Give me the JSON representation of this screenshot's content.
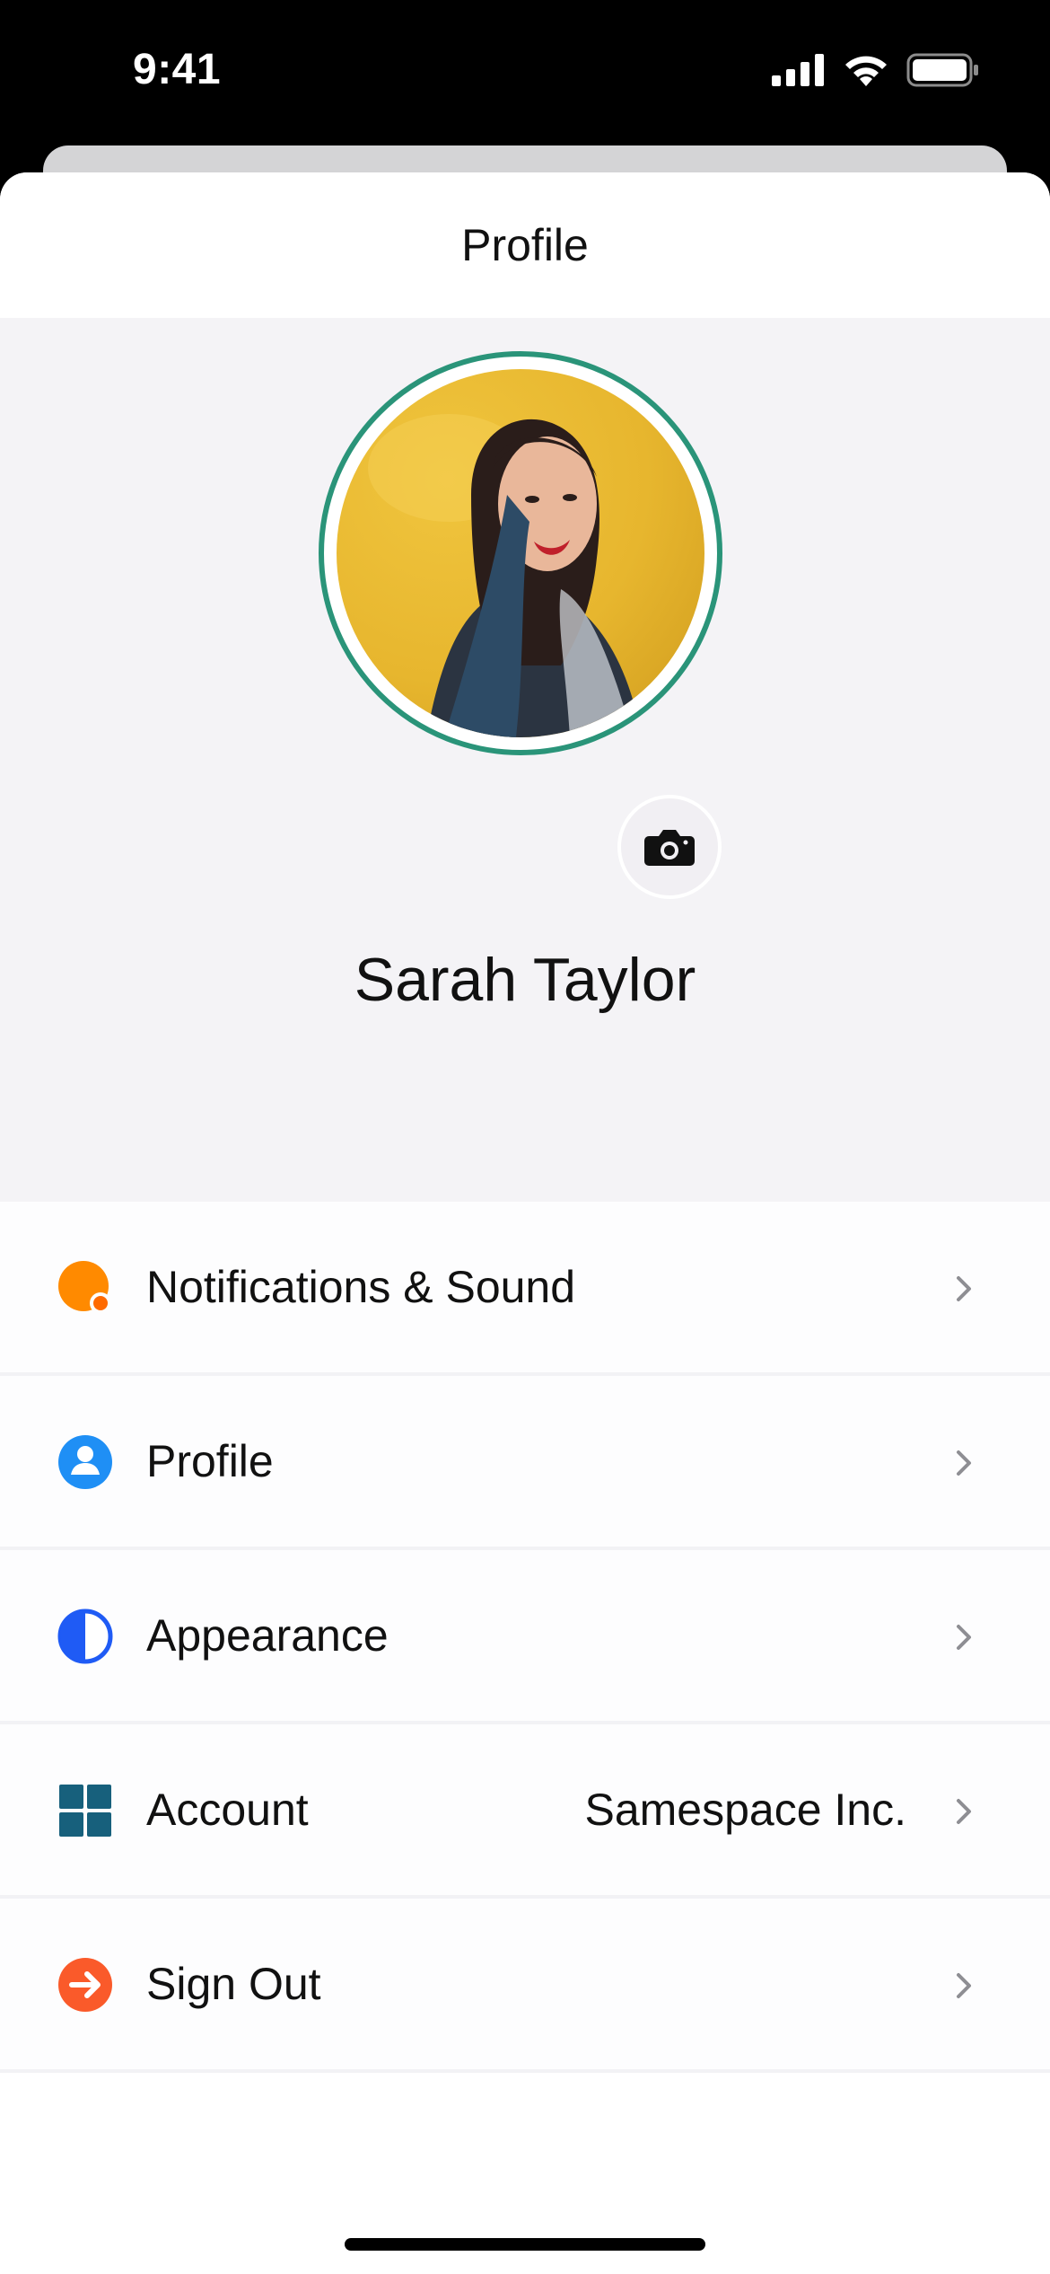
{
  "status_bar": {
    "time": "9:41",
    "icons": [
      "cellular-signal-icon",
      "wifi-icon",
      "battery-icon"
    ]
  },
  "nav": {
    "title": "Profile"
  },
  "profile": {
    "name": "Sarah Taylor",
    "avatar_ring_color": "#2a9479",
    "camera_icon": "camera-icon"
  },
  "menu": {
    "items": [
      {
        "label": "Notifications & Sound",
        "icon": "notifications-icon",
        "color": "#ff8a00",
        "value": ""
      },
      {
        "label": "Profile",
        "icon": "profile-icon",
        "color": "#1f8ff5",
        "value": ""
      },
      {
        "label": "Appearance",
        "icon": "appearance-icon",
        "color": "#1f5bf5",
        "value": ""
      },
      {
        "label": "Account",
        "icon": "account-grid-icon",
        "color": "#17607c",
        "value": "Samespace Inc."
      },
      {
        "label": "Sign Out",
        "icon": "sign-out-icon",
        "color": "#fa5a2a",
        "value": ""
      }
    ]
  }
}
